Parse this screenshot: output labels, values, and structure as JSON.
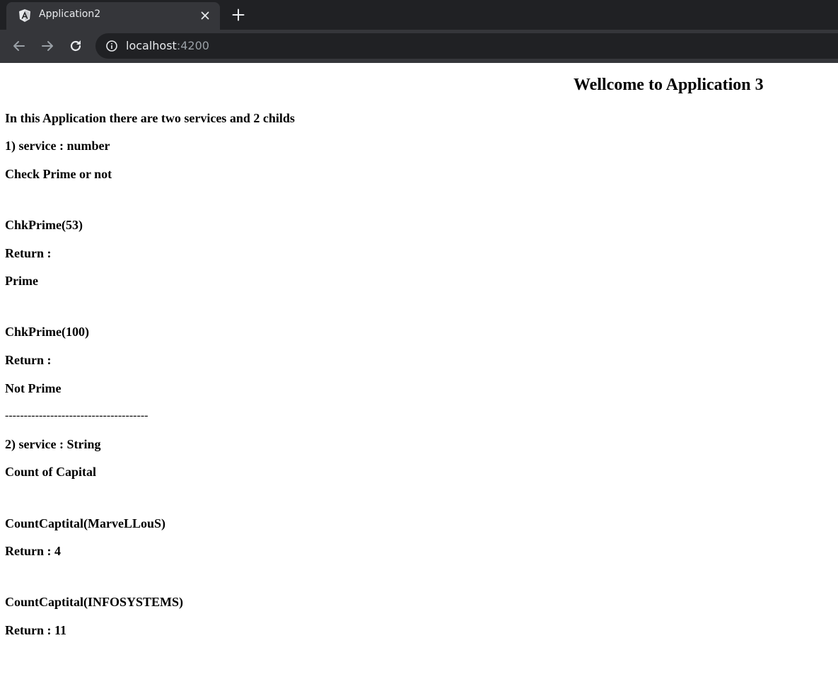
{
  "browser": {
    "tab_title": "Application2",
    "url_host": "localhost",
    "url_port": ":4200",
    "accent": "#35363a"
  },
  "page": {
    "heading": "Wellcome to Application 3",
    "intro": "In this Application there are two services and 2 childs",
    "service1_title": "1) service : number",
    "service1_desc": "Check Prime or not",
    "call1": "ChkPrime(53)",
    "return1_label": "Return :",
    "result1": "Prime",
    "call2": "ChkPrime(100)",
    "return2_label": "Return :",
    "result2": "Not Prime",
    "separator": "--------------------------------------",
    "service2_title": "2) service : String",
    "service2_desc": "Count of Capital",
    "call3": "CountCaptital(MarveLLouS)",
    "return3": "Return : 4",
    "call4": "CountCaptital(INFOSYSTEMS)",
    "return4": "Return : 11"
  }
}
